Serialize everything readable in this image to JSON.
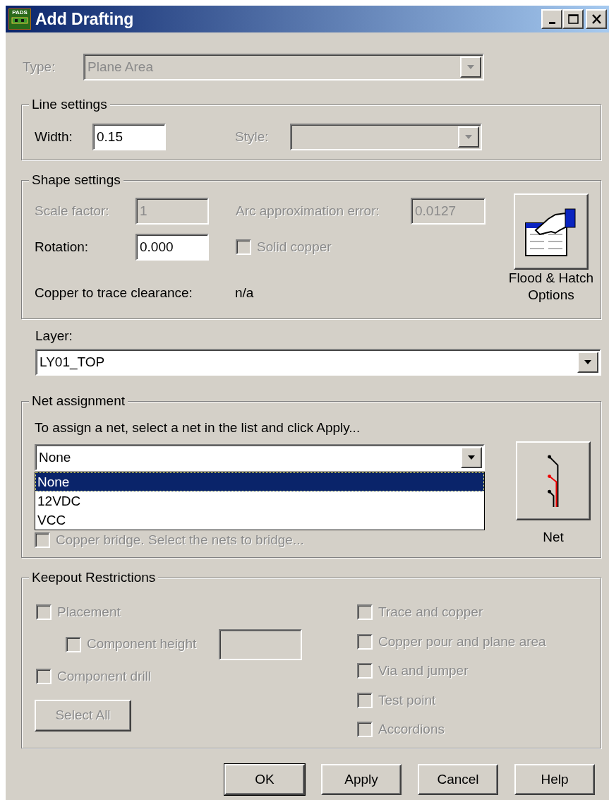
{
  "window": {
    "title": "Add Drafting",
    "icon_text": "PADS"
  },
  "type_field": {
    "label": "Type:",
    "value": "Plane Area",
    "disabled": true
  },
  "line_settings": {
    "title": "Line settings",
    "width": {
      "label": "Width:",
      "value": "0.15"
    },
    "style": {
      "label": "Style:",
      "disabled": true
    }
  },
  "shape_settings": {
    "title": "Shape settings",
    "scale_factor": {
      "label": "Scale factor:",
      "value": "1",
      "disabled": true
    },
    "arc_error": {
      "label": "Arc approximation error:",
      "value": "0.0127",
      "disabled": true
    },
    "rotation": {
      "label": "Rotation:",
      "value": "0.000"
    },
    "solid_copper": {
      "label": "Solid copper",
      "checked": false,
      "disabled": true
    },
    "clearance": {
      "label": "Copper to trace clearance:",
      "value": "n/a"
    },
    "flood_button": {
      "label": "Flood & Hatch Options"
    }
  },
  "layer": {
    "label": "Layer:",
    "value": "LY01_TOP"
  },
  "net_assignment": {
    "title": "Net assignment",
    "instruction": "To assign a net, select a net in the list and click Apply...",
    "value": "None",
    "options": [
      {
        "label": "None",
        "selected": true
      },
      {
        "label": "12VDC",
        "selected": false
      },
      {
        "label": "VCC",
        "selected": false
      }
    ],
    "copper_bridge": {
      "label": "Copper bridge. Select the nets to bridge...",
      "checked": false,
      "disabled": true
    },
    "net_button": {
      "label": "Net"
    }
  },
  "keepout": {
    "title": "Keepout Restrictions",
    "left": [
      {
        "label": "Placement",
        "checked": false,
        "disabled": true,
        "children": [
          {
            "label": "Component height",
            "checked": false,
            "disabled": true,
            "field": {
              "disabled": true
            }
          }
        ]
      },
      {
        "label": "Component drill",
        "checked": false,
        "disabled": true
      }
    ],
    "right": [
      {
        "label": "Trace and copper",
        "checked": false,
        "disabled": true
      },
      {
        "label": "Copper pour and plane area",
        "checked": false,
        "disabled": true
      },
      {
        "label": "Via and jumper",
        "checked": false,
        "disabled": true
      },
      {
        "label": "Test point",
        "checked": false,
        "disabled": true
      },
      {
        "label": "Accordions",
        "checked": false,
        "disabled": true
      }
    ],
    "select_all": {
      "label": "Select All",
      "disabled": true
    }
  },
  "buttons": [
    {
      "label": "OK",
      "default": true
    },
    {
      "label": "Apply",
      "default": false
    },
    {
      "label": "Cancel",
      "default": false
    },
    {
      "label": "Help",
      "default": false
    }
  ]
}
